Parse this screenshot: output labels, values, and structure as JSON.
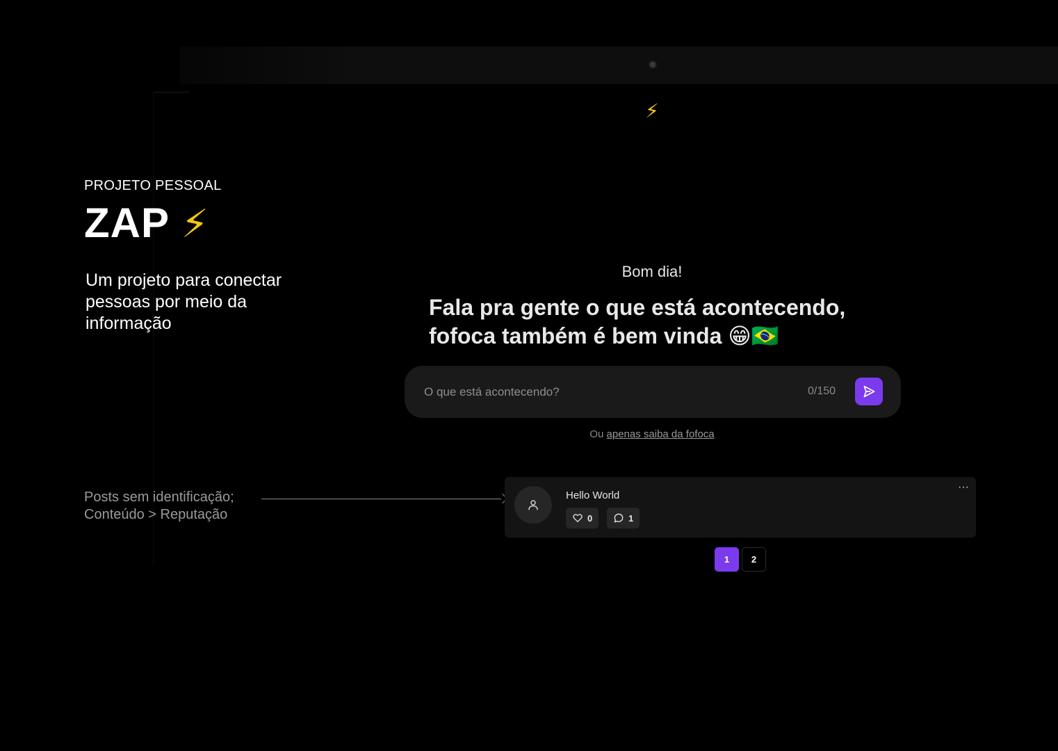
{
  "left_panel": {
    "kicker": "PROJETO PESSOAL",
    "brand": "ZAP",
    "brand_emoji": "⚡",
    "description": "Um projeto para conectar pessoas por meio da informação",
    "feature_line1": "Posts sem identificação;",
    "feature_line2": "Conteúdo > Reputação"
  },
  "app": {
    "logo_emoji": "⚡",
    "greeting": "Bom dia!",
    "headline": "Fala pra gente o que está acontecendo, fofoca também é bem vinda 😁🇧🇷",
    "composer": {
      "placeholder": "O que está acontecendo?",
      "value": "",
      "counter": "0/150"
    },
    "alt_prefix": "Ou",
    "alt_link": "apenas saiba da fofoca",
    "posts": [
      {
        "text": "Hello World",
        "likes": "0",
        "comments": "1",
        "menu": "···"
      }
    ],
    "pagination": [
      "1",
      "2"
    ],
    "accent_color": "#7c3aed"
  }
}
